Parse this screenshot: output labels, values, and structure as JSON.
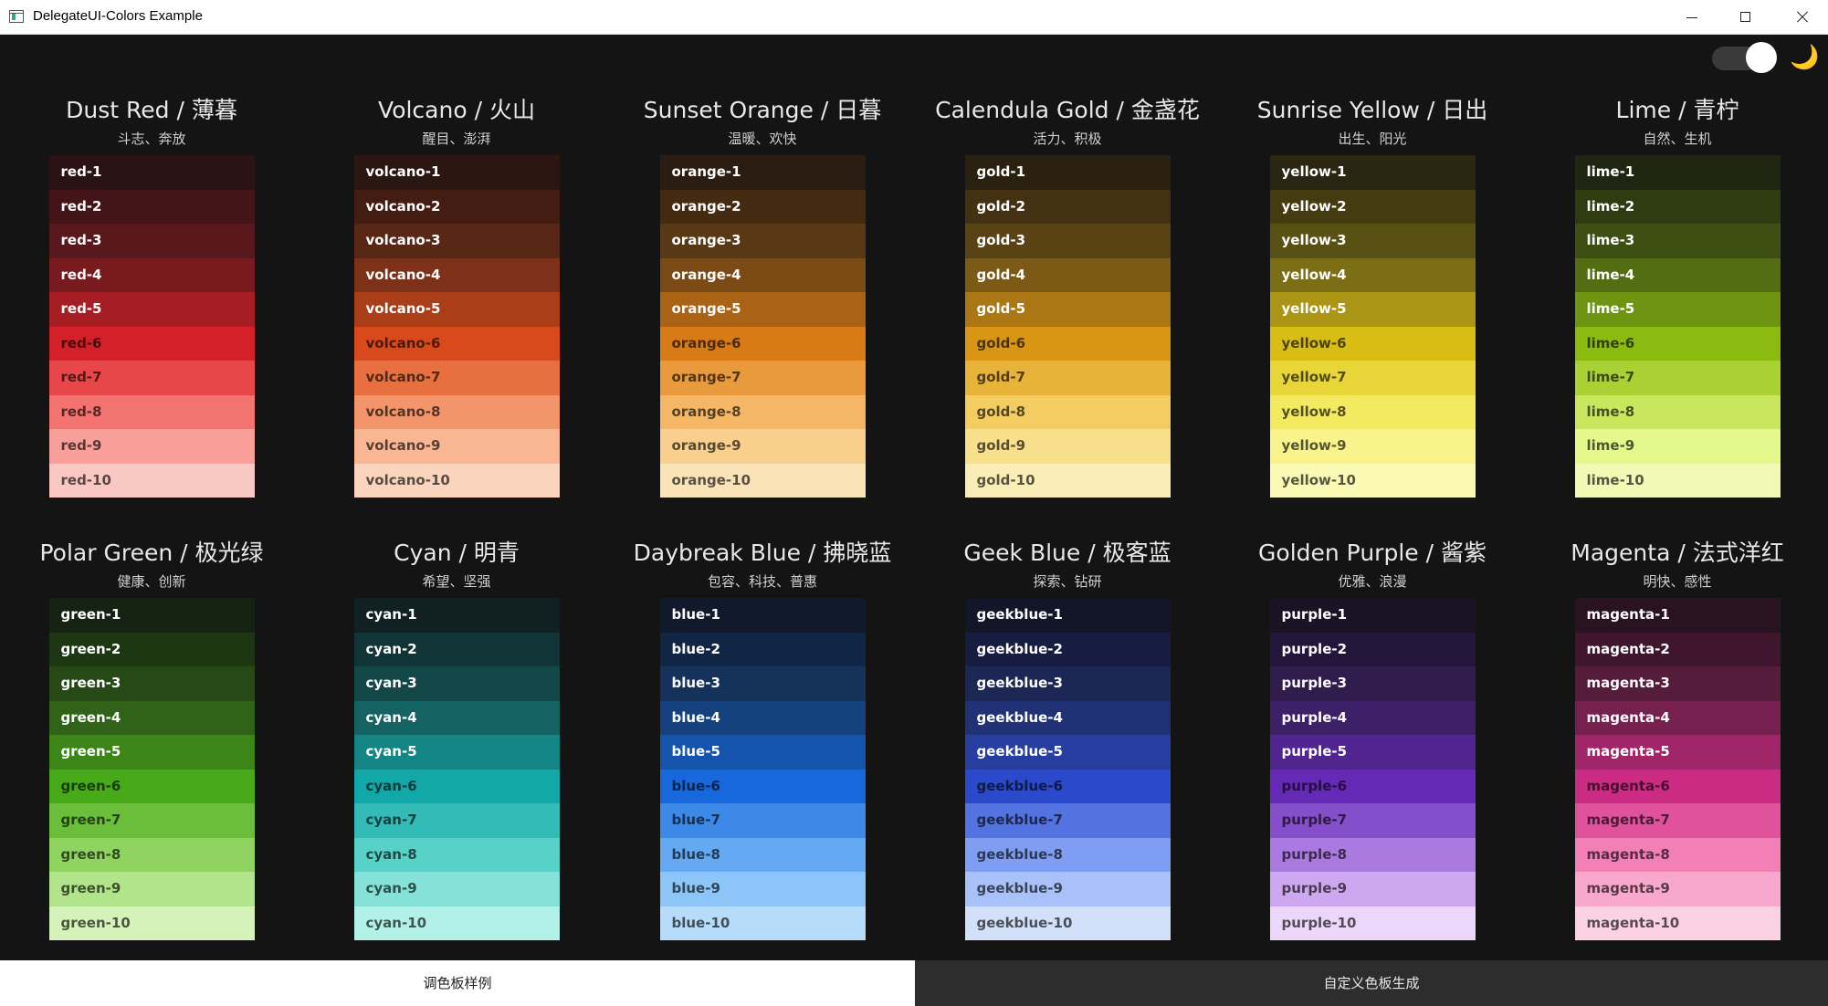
{
  "window": {
    "title": "DelegateUI-Colors Example"
  },
  "theme": {
    "icon": "moon-icon",
    "glyph": "🌙",
    "mode": "dark"
  },
  "palettes": [
    {
      "title": "Dust Red / 薄暮",
      "desc": "斗志、奔放",
      "labels": [
        "red-1",
        "red-2",
        "red-3",
        "red-4",
        "red-5",
        "red-6",
        "red-7",
        "red-8",
        "red-9",
        "red-10"
      ],
      "colors": [
        "#2a1215",
        "#431418",
        "#58181c",
        "#791a1f",
        "#a61d24",
        "#d32029",
        "#e84749",
        "#f37370",
        "#f89f9a",
        "#fac8c3"
      ]
    },
    {
      "title": "Volcano / 火山",
      "desc": "醒目、澎湃",
      "labels": [
        "volcano-1",
        "volcano-2",
        "volcano-3",
        "volcano-4",
        "volcano-5",
        "volcano-6",
        "volcano-7",
        "volcano-8",
        "volcano-9",
        "volcano-10"
      ],
      "colors": [
        "#2b1611",
        "#441d12",
        "#592716",
        "#7c3118",
        "#aa3e19",
        "#d84a1b",
        "#e87040",
        "#f3956a",
        "#f8b692",
        "#fad4bc"
      ]
    },
    {
      "title": "Sunset Orange / 日暮",
      "desc": "温暖、欢快",
      "labels": [
        "orange-1",
        "orange-2",
        "orange-3",
        "orange-4",
        "orange-5",
        "orange-6",
        "orange-7",
        "orange-8",
        "orange-9",
        "orange-10"
      ],
      "colors": [
        "#2b1d11",
        "#442a11",
        "#593815",
        "#7c4a15",
        "#aa6215",
        "#d87a16",
        "#e89a3c",
        "#f3b765",
        "#f8cf8d",
        "#fae3b7"
      ]
    },
    {
      "title": "Calendula Gold / 金盏花",
      "desc": "活力、积极",
      "labels": [
        "gold-1",
        "gold-2",
        "gold-3",
        "gold-4",
        "gold-5",
        "gold-6",
        "gold-7",
        "gold-8",
        "gold-9",
        "gold-10"
      ],
      "colors": [
        "#2b2111",
        "#443111",
        "#594214",
        "#7c5914",
        "#aa7714",
        "#d89614",
        "#e8b339",
        "#f3cc62",
        "#f8df8b",
        "#faedb5"
      ]
    },
    {
      "title": "Sunrise Yellow / 日出",
      "desc": "出生、阳光",
      "labels": [
        "yellow-1",
        "yellow-2",
        "yellow-3",
        "yellow-4",
        "yellow-5",
        "yellow-6",
        "yellow-7",
        "yellow-8",
        "yellow-9",
        "yellow-10"
      ],
      "colors": [
        "#2b2611",
        "#443b11",
        "#595014",
        "#7c6e14",
        "#aa9514",
        "#d8bd14",
        "#e8d639",
        "#f3ea62",
        "#f8f48b",
        "#fafab5"
      ]
    },
    {
      "title": "Lime / 青柠",
      "desc": "自然、生机",
      "labels": [
        "lime-1",
        "lime-2",
        "lime-3",
        "lime-4",
        "lime-5",
        "lime-6",
        "lime-7",
        "lime-8",
        "lime-9",
        "lime-10"
      ],
      "colors": [
        "#1f2611",
        "#2e3c10",
        "#3e4f13",
        "#536d13",
        "#6f9412",
        "#8bbb11",
        "#a9d134",
        "#c9e75d",
        "#e4f88b",
        "#f0fab5"
      ]
    },
    {
      "title": "Polar Green / 极光绿",
      "desc": "健康、创新",
      "labels": [
        "green-1",
        "green-2",
        "green-3",
        "green-4",
        "green-5",
        "green-6",
        "green-7",
        "green-8",
        "green-9",
        "green-10"
      ],
      "colors": [
        "#162312",
        "#1d3712",
        "#274916",
        "#306317",
        "#3c8618",
        "#49aa19",
        "#6abe39",
        "#8fd460",
        "#b2e58b",
        "#d5f2bb"
      ]
    },
    {
      "title": "Cyan / 明青",
      "desc": "希望、坚强",
      "labels": [
        "cyan-1",
        "cyan-2",
        "cyan-3",
        "cyan-4",
        "cyan-5",
        "cyan-6",
        "cyan-7",
        "cyan-8",
        "cyan-9",
        "cyan-10"
      ],
      "colors": [
        "#112123",
        "#113536",
        "#144848",
        "#146262",
        "#138585",
        "#13a8a8",
        "#33bcb7",
        "#58d1c9",
        "#84e2d8",
        "#b2f1e8"
      ]
    },
    {
      "title": "Daybreak Blue / 拂晓蓝",
      "desc": "包容、科技、普惠",
      "labels": [
        "blue-1",
        "blue-2",
        "blue-3",
        "blue-4",
        "blue-5",
        "blue-6",
        "blue-7",
        "blue-8",
        "blue-9",
        "blue-10"
      ],
      "colors": [
        "#111a2c",
        "#112545",
        "#15325b",
        "#15417e",
        "#1554ad",
        "#1668dc",
        "#3c89e8",
        "#65a9f3",
        "#8dc5f8",
        "#b7dcfa"
      ]
    },
    {
      "title": "Geek Blue / 极客蓝",
      "desc": "探索、钻研",
      "labels": [
        "geekblue-1",
        "geekblue-2",
        "geekblue-3",
        "geekblue-4",
        "geekblue-5",
        "geekblue-6",
        "geekblue-7",
        "geekblue-8",
        "geekblue-9",
        "geekblue-10"
      ],
      "colors": [
        "#131629",
        "#161d40",
        "#1c2755",
        "#203175",
        "#263ea0",
        "#2b4acb",
        "#5273e0",
        "#7f9ef3",
        "#a8c1f8",
        "#d2e0fa"
      ]
    },
    {
      "title": "Golden Purple / 酱紫",
      "desc": "优雅、浪漫",
      "labels": [
        "purple-1",
        "purple-2",
        "purple-3",
        "purple-4",
        "purple-5",
        "purple-6",
        "purple-7",
        "purple-8",
        "purple-9",
        "purple-10"
      ],
      "colors": [
        "#1a1325",
        "#24163a",
        "#301c4d",
        "#3e2069",
        "#51258f",
        "#642ab5",
        "#854eca",
        "#ab7ae0",
        "#cda8f0",
        "#ebd7fa"
      ]
    },
    {
      "title": "Magenta / 法式洋红",
      "desc": "明快、感性",
      "labels": [
        "magenta-1",
        "magenta-2",
        "magenta-3",
        "magenta-4",
        "magenta-5",
        "magenta-6",
        "magenta-7",
        "magenta-8",
        "magenta-9",
        "magenta-10"
      ],
      "colors": [
        "#291321",
        "#40162f",
        "#551c3b",
        "#75204f",
        "#a02669",
        "#cb2b83",
        "#e0529c",
        "#f37fb7",
        "#f8a8cc",
        "#fad2e3"
      ]
    }
  ],
  "tabs": [
    {
      "label": "调色板样例",
      "active": true
    },
    {
      "label": "自定义色板生成",
      "active": false
    }
  ]
}
